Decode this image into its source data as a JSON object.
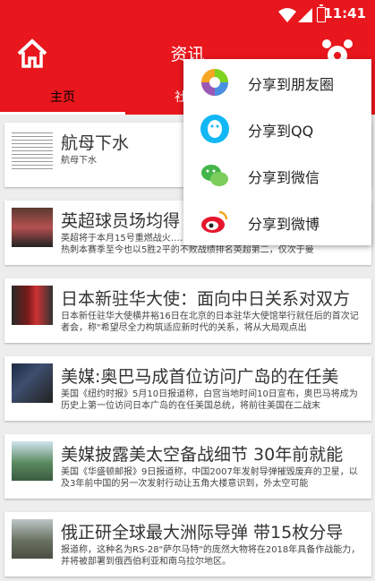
{
  "status": {
    "time": "11:41"
  },
  "toolbar": {
    "title": "资讯"
  },
  "tabs": [
    "主页",
    "社"
  ],
  "news": [
    {
      "title": "航母下水",
      "desc": "航母下水"
    },
    {
      "title": "英超球员场均得",
      "desc": "英超将于本月15号重燃战火……平的不败战绩排名英超第二，仅次于曼屋。热刺本赛季至今也以5胜2平的不败战绩排名英超第二，仅次于曼"
    },
    {
      "title": "日本新驻华大使：面向中日关系对双方",
      "desc": "日本新任驻华大使横井裕16日在北京的日本驻华大使馆举行就任后的首次记者会，称\"希望尽全力构筑适应新时代的关系，将从大局观点出"
    },
    {
      "title": "美媒:奥巴马成首位访问广岛的在任美",
      "desc": "美国《纽约时报》5月10日报道称，白宫当地时间10日宣布，奥巴马将成为历史上第一位访问日本广岛的在任美国总统，将前往美国在二战末"
    },
    {
      "title": "美媒披露美太空备战细节 30年前就能",
      "desc": "美国《华盛顿邮报》9日报道称，中国2007年发射导弹摧毁废弃的卫星，以及3年前中国的另一次发射行动让五角大楼意识到，外太空可能"
    },
    {
      "title": "俄正研全球最大洲际导弹 带15枚分导",
      "desc": "报道称，这种名为RS-28\"萨尔马特\"的庞然大物将在2018年具备作战能力，并将被部署到俄西伯利亚和南乌拉尔地区。"
    }
  ],
  "share_menu": [
    {
      "label": "分享到朋友圈",
      "icon": "moments-icon"
    },
    {
      "label": "分享到QQ",
      "icon": "qq-icon"
    },
    {
      "label": "分享到微信",
      "icon": "wechat-icon"
    },
    {
      "label": "分享到微博",
      "icon": "weibo-icon"
    }
  ],
  "colors": {
    "primary": "#e8161d",
    "background": "#ededed"
  }
}
